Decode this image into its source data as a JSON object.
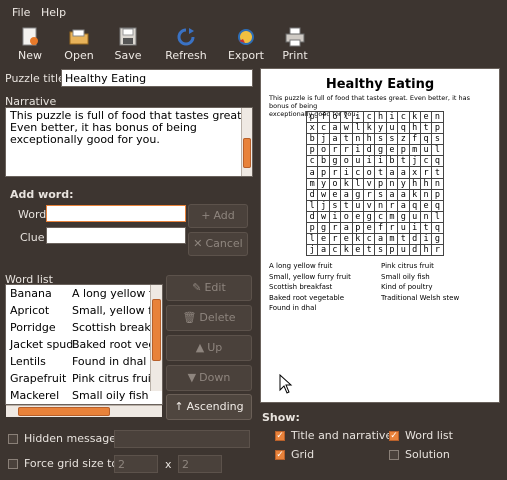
{
  "menu": {
    "file": "File",
    "help": "Help"
  },
  "toolbar": {
    "new": "New",
    "open": "Open",
    "save": "Save",
    "refresh": "Refresh",
    "export": "Export",
    "print": "Print"
  },
  "puzzle": {
    "title_label": "Puzzle title",
    "title_value": "Healthy Eating",
    "narrative_label": "Narrative",
    "narrative_lines": [
      "This puzzle is full of food that tastes great.",
      "Even better, it has bonus of being",
      "exceptionally good for you."
    ]
  },
  "add_word": {
    "heading": "Add word:",
    "word_label": "Word",
    "clue_label": "Clue",
    "word_value": "",
    "clue_value": "",
    "add_button": "Add",
    "cancel_button": "Cancel"
  },
  "word_list": {
    "label": "Word list",
    "rows": [
      {
        "word": "Banana",
        "clue": "A long yellow f"
      },
      {
        "word": "Apricot",
        "clue": "Small, yellow f"
      },
      {
        "word": "Porridge",
        "clue": "Scottish breakf"
      },
      {
        "word": "Jacket spud",
        "clue": "Baked root veg"
      },
      {
        "word": "Lentils",
        "clue": "Found in dhal"
      },
      {
        "word": "Grapefruit",
        "clue": "Pink citrus fruit"
      },
      {
        "word": "Mackerel",
        "clue": "Small oily fish"
      }
    ]
  },
  "list_buttons": {
    "edit": "Edit",
    "delete": "Delete",
    "up": "Up",
    "down": "Down",
    "ascending": "Ascending"
  },
  "options": {
    "hidden_message": "Hidden message",
    "force_grid": "Force grid size to",
    "grid_w": "2",
    "times": "x",
    "grid_h": "2"
  },
  "preview": {
    "title": "Healthy Eating",
    "narrative_lines": [
      "This puzzle is full of food that tastes great. Even better, it has bonus of being",
      "exceptionally good for you."
    ],
    "grid": [
      "pfolichicken",
      "xcawlkyuqhtp",
      "bjatnhsszfqs",
      "porridgepmul",
      "cbgouiibtjcqi",
      "apricotaaxrt",
      "myoklvpnyhhn",
      "dweagrsaaknp",
      "ljstuvnraqeq",
      "dwioegcmgunl",
      "pgrapefruitq",
      "lerekcamtdig",
      "jacketspudhr"
    ],
    "clues_left": [
      "A long yellow fruit",
      "Small, yellow furry fruit",
      "Scottish breakfast",
      "Baked root vegetable",
      "Found in dhal"
    ],
    "clues_right": [
      "Pink citrus fruit",
      "Small oily fish",
      "Kind of poultry",
      "Traditional Welsh stew"
    ]
  },
  "show": {
    "heading": "Show:",
    "title_narrative": "Title and narrative",
    "word_list": "Word list",
    "grid": "Grid",
    "solution": "Solution",
    "title_narrative_on": true,
    "word_list_on": true,
    "grid_on": true,
    "solution_on": false
  }
}
